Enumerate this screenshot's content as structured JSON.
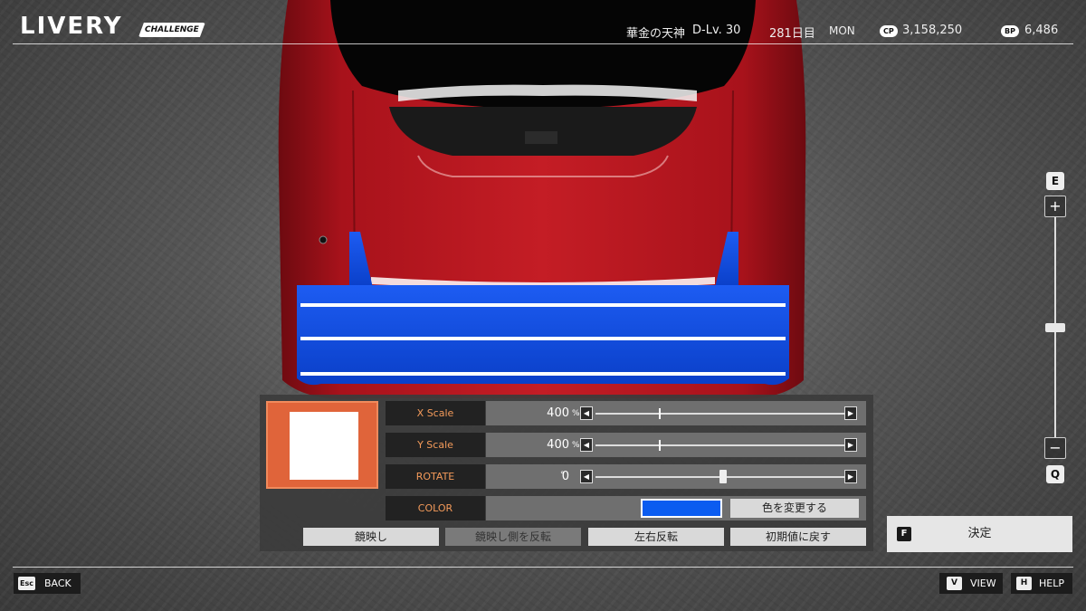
{
  "header": {
    "title": "LIVERY",
    "badge": "CHALLENGE",
    "player_name": "華金の天神",
    "driver_level": "D-Lv. 30",
    "day": "281日目",
    "weekday": "MON",
    "cp_label": "CP",
    "cp_value": "3,158,250",
    "bp_label": "BP",
    "bp_value": "6,486"
  },
  "zoom": {
    "top_key": "E",
    "bottom_key": "Q",
    "plus": "+",
    "minus": "−",
    "level": 0.5
  },
  "editor": {
    "rows": [
      {
        "label": "X Scale",
        "value": "400",
        "unit": "%",
        "marker": 0.25,
        "position": 1.0
      },
      {
        "label": "Y Scale",
        "value": "400",
        "unit": "%",
        "marker": 0.25,
        "position": 1.0
      },
      {
        "label": "ROTATE",
        "value": "0",
        "unit": "°",
        "marker": null,
        "position": 0.5
      }
    ],
    "color_label": "COLOR",
    "color_value": "#0b5cf0",
    "change_color_label": "色を変更する",
    "buttons": [
      "鏡映し",
      "鏡映し側を反転",
      "左右反転",
      "初期値に戻す"
    ],
    "decal_color": "#ffffff",
    "selected_color": "#e0643a"
  },
  "confirm": {
    "key": "F",
    "label": "決定"
  },
  "footer": {
    "back_key": "Esc",
    "back_label": "BACK",
    "view_key": "V",
    "view_label": "VIEW",
    "help_key": "H",
    "help_label": "HELP"
  },
  "colors": {
    "car_body": "#b3141c",
    "wing": "#0b4fe0"
  }
}
